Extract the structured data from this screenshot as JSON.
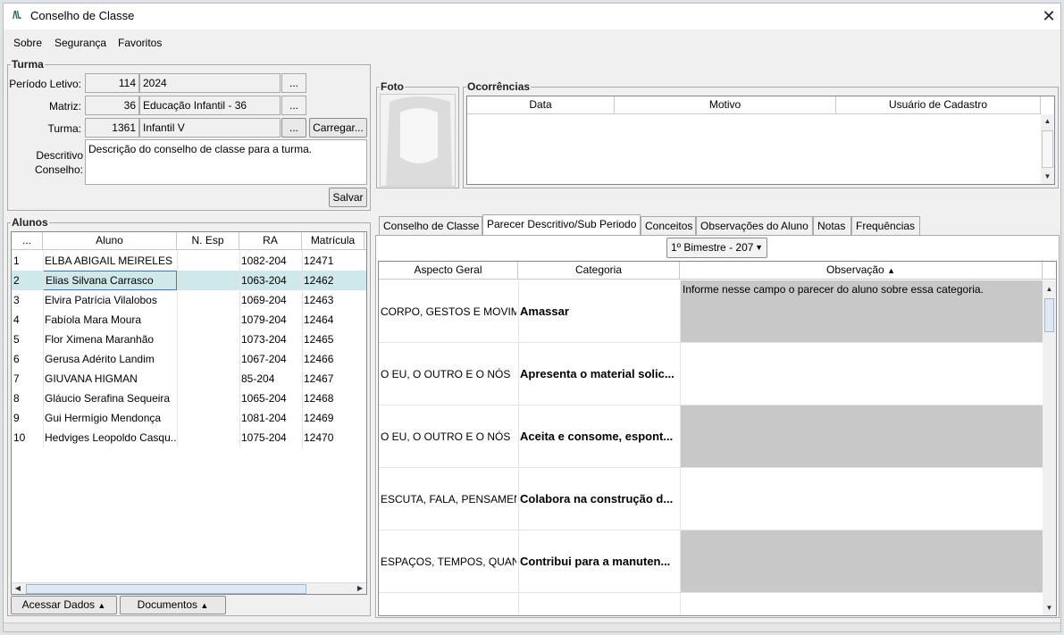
{
  "window": {
    "title": "Conselho de Classe",
    "logo": "/\\\\."
  },
  "menu": [
    "Sobre",
    "Segurança",
    "Favoritos"
  ],
  "turma": {
    "legend": "Turma",
    "periodo_label": "Período Letivo:",
    "periodo_code": "114",
    "periodo_name": "2024",
    "matriz_label": "Matriz:",
    "matriz_code": "36",
    "matriz_name": "Educação Infantil - 36",
    "turma_label": "Turma:",
    "turma_code": "1361",
    "turma_name": "Infantil V",
    "ellipsis": "...",
    "carregar": "Carregar...",
    "descritivo_label_1": "Descritivo",
    "descritivo_label_2": "Conselho:",
    "descritivo_text": "Descrição do conselho de classe para a turma.",
    "salvar": "Salvar"
  },
  "foto": {
    "legend": "Foto"
  },
  "ocorrencias": {
    "legend": "Ocorrências",
    "columns": [
      "Data",
      "Motivo",
      "Usuário de Cadastro"
    ]
  },
  "alunos": {
    "legend": "Alunos",
    "columns": [
      "...",
      "Aluno",
      "N. Esp",
      "RA",
      "Matrícula"
    ],
    "rows": [
      {
        "n": "1",
        "aluno": "ELBA ABIGAIL MEIRELES",
        "esp": "",
        "ra": "1082-204",
        "mat": "12471"
      },
      {
        "n": "2",
        "aluno": "Elias Silvana Carrasco",
        "esp": "",
        "ra": "1063-204",
        "mat": "12462"
      },
      {
        "n": "3",
        "aluno": "Elvira Patrícia Vilalobos",
        "esp": "",
        "ra": "1069-204",
        "mat": "12463"
      },
      {
        "n": "4",
        "aluno": "Fabíola Mara Moura",
        "esp": "",
        "ra": "1079-204",
        "mat": "12464"
      },
      {
        "n": "5",
        "aluno": "Flor Ximena Maranhão",
        "esp": "",
        "ra": "1073-204",
        "mat": "12465"
      },
      {
        "n": "6",
        "aluno": "Gerusa Adérito Landim",
        "esp": "",
        "ra": "1067-204",
        "mat": "12466"
      },
      {
        "n": "7",
        "aluno": "GIUVANA HIGMAN",
        "esp": "",
        "ra": "85-204",
        "mat": "12467"
      },
      {
        "n": "8",
        "aluno": "Gláucio Serafina Sequeira",
        "esp": "",
        "ra": "1065-204",
        "mat": "12468"
      },
      {
        "n": "9",
        "aluno": "Gui Hermígio Mendonça",
        "esp": "",
        "ra": "1081-204",
        "mat": "12469"
      },
      {
        "n": "10",
        "aluno": "Hedviges Leopoldo Casqu...",
        "esp": "",
        "ra": "1075-204",
        "mat": "12470"
      }
    ],
    "selected_row": 2,
    "acessar_dados": "Acessar Dados",
    "documentos": "Documentos"
  },
  "tabs": [
    "Conselho de Classe",
    "Parecer Descritivo/Sub Periodo",
    "Conceitos",
    "Observações do Aluno",
    "Notas",
    "Frequências"
  ],
  "active_tab": 1,
  "parecer": {
    "bimestre": "1º Bimestre - 207",
    "columns": [
      "Aspecto Geral",
      "Categoria",
      "Observação"
    ],
    "sort_indicator": "▲",
    "rows": [
      {
        "aspecto": "CORPO, GESTOS E MOVIM...",
        "categoria": "Amassar",
        "observacao": "Informe nesse campo o parecer do aluno sobre essa categoria.",
        "shaded": true
      },
      {
        "aspecto": "O EU, O OUTRO E O NÓS",
        "categoria": "Apresenta o material solic...",
        "observacao": "",
        "shaded": false
      },
      {
        "aspecto": "O EU, O OUTRO E O NÓS",
        "categoria": "Aceita e consome, espont...",
        "observacao": "",
        "shaded": true
      },
      {
        "aspecto": "ESCUTA, FALA, PENSAMEN...",
        "categoria": "Colabora na construção d...",
        "observacao": "",
        "shaded": false
      },
      {
        "aspecto": "ESPAÇOS, TEMPOS, QUAN...",
        "categoria": "Contribui para a manuten...",
        "observacao": "",
        "shaded": true
      }
    ]
  }
}
